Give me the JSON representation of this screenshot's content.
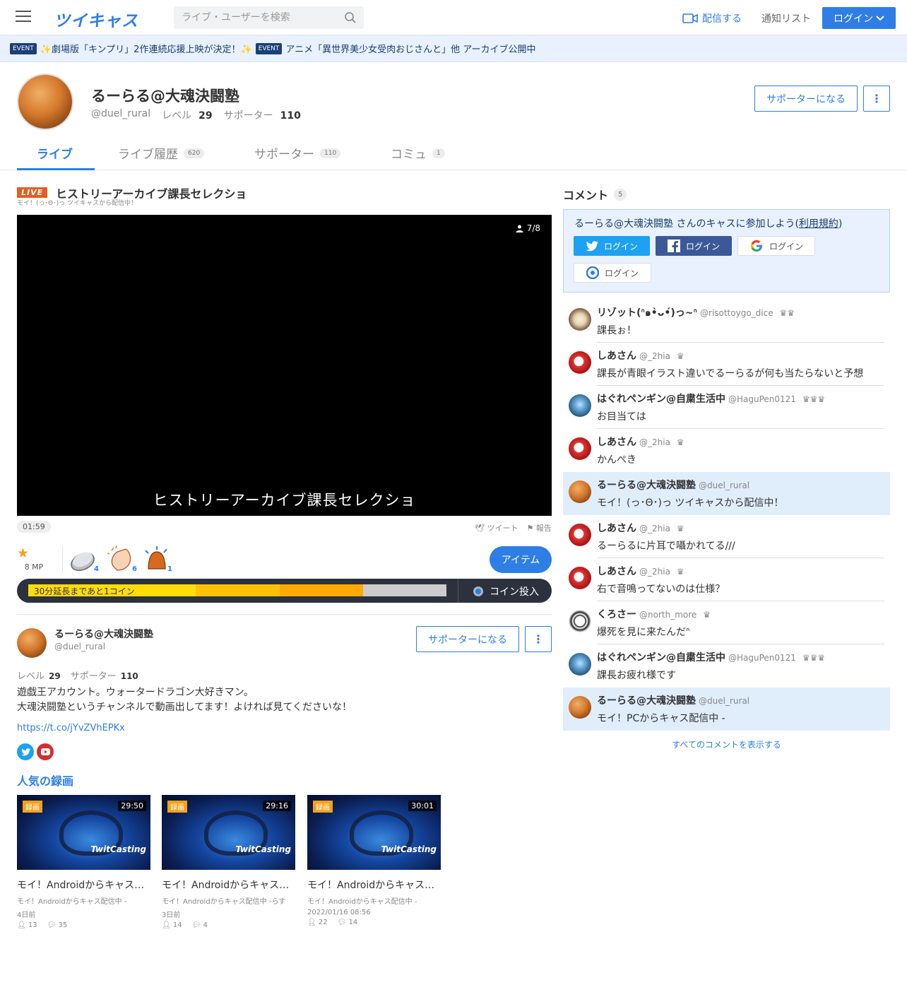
{
  "header": {
    "logo": "ツイキャス",
    "search_placeholder": "ライブ・ユーザーを検索",
    "cast_label": "配信する",
    "notify_label": "通知リスト",
    "login_label": "ログイン"
  },
  "events": [
    {
      "tag": "EVENT",
      "text": "✨劇場版「キンプリ」2作連続応援上映が決定！✨"
    },
    {
      "tag": "EVENT",
      "text": "アニメ「異世界美少女受肉おじさんと」他 アーカイブ公開中"
    }
  ],
  "profile": {
    "name": "るーらる@大魂決闘塾",
    "handle": "@duel_rural",
    "level_label": "レベル",
    "level": "29",
    "supporter_label": "サポーター",
    "supporters": "110",
    "supporter_button": "サポーターになる",
    "more": "⋮"
  },
  "tabs": [
    {
      "label": "ライブ",
      "count": ""
    },
    {
      "label": "ライブ履歴",
      "count": "620"
    },
    {
      "label": "サポーター",
      "count": "110"
    },
    {
      "label": "コミュ",
      "count": "1"
    }
  ],
  "live": {
    "tag": "LIVE",
    "title": "ヒストリーアーカイブ課長セレクショ",
    "subtitle": "モイ！(っ･Θ･)っ ツイキャスから配信中！",
    "viewers": "7/8",
    "player_title": "ヒストリーアーカイブ課長セレクショ",
    "time": "01:59",
    "tweet": "ツイート",
    "report": "報告",
    "mp": "8 MP",
    "gifts": [
      {
        "name": "coin",
        "count": "4"
      },
      {
        "name": "clap",
        "count": "6"
      },
      {
        "name": "bell",
        "count": "1"
      }
    ],
    "item_button": "アイテム",
    "progress_label": "30分延長まであと1コイン",
    "progress": 0.81,
    "coin_button": "コイン投入"
  },
  "about": {
    "name": "るーらる@大魂決闘塾",
    "handle": "@duel_rural",
    "supporter_button": "サポーターになる",
    "level_label": "レベル",
    "level": "29",
    "supporter_label": "サポーター",
    "supporters": "110",
    "bio1": "遊戯王アカウント。ウォータードラゴン大好きマン。",
    "bio2": "大魂決闘塾というチャンネルで動画出してます！よければ見てくださいな！",
    "link": "https://t.co/jYvZVhEPKx",
    "popular_title": "人気の録画"
  },
  "recordings": [
    {
      "tag": "録画",
      "duration": "29:50",
      "title": "モイ！Androidからキャス配信中 -",
      "sub": "モイ！Androidからキャス配信中 -",
      "date": "4日前",
      "viewers": "13",
      "comments": "35"
    },
    {
      "tag": "録画",
      "duration": "29:16",
      "title": "モイ！Androidからキャス配信中 -",
      "sub": "モイ！Androidからキャス配信中 -らす",
      "date": "3日前",
      "viewers": "14",
      "comments": "4"
    },
    {
      "tag": "録画",
      "duration": "30:01",
      "title": "モイ！Androidからキャス配信中 -",
      "sub": "モイ！Androidからキャス配信中 -",
      "date": "2022/01/16 08:56",
      "viewers": "22",
      "comments": "14"
    }
  ],
  "comments_panel": {
    "title": "コメント",
    "count": "5",
    "join_prefix": "るーらる@大魂決闘塾 さんのキャスに参加しよう(",
    "join_link": "利用規約",
    "join_suffix": ")",
    "login_twitter": "ログイン",
    "login_facebook": "ログイン",
    "login_google": "ログイン",
    "login_other": "ログイン",
    "show_all": "すべてのコメントを表示する"
  },
  "comments": [
    {
      "name": "リゾット(ᐢ๑•̀ᴗ•́)っ~ᐢ",
      "id": "@risottoygo_dice",
      "badge": "♛♛",
      "text": "課長ぉ！",
      "avatar": "mix",
      "highlight": false
    },
    {
      "name": "しあさん",
      "id": "@_2hia",
      "badge": "♛",
      "text": "課長が青眼イラスト違いでるーらるが何も当たらないと予想",
      "avatar": "red",
      "highlight": false
    },
    {
      "name": "はぐれペンギン@自粛生活中",
      "id": "@HaguPen0121",
      "badge": "♛♛♛",
      "text": "お目当ては",
      "avatar": "peng",
      "highlight": false
    },
    {
      "name": "しあさん",
      "id": "@_2hia",
      "badge": "♛",
      "text": "かんぺき",
      "avatar": "red",
      "highlight": false
    },
    {
      "name": "るーらる@大魂決闘塾",
      "id": "@duel_rural",
      "badge": "",
      "text": "モイ！(っ･Θ･)っ ツイキャスから配信中！",
      "avatar": "bun",
      "highlight": true
    },
    {
      "name": "しあさん",
      "id": "@_2hia",
      "badge": "♛",
      "text": "るーらるに片耳で囁かれてる///",
      "avatar": "red",
      "highlight": false
    },
    {
      "name": "しあさん",
      "id": "@_2hia",
      "badge": "♛",
      "text": "右で音鳴ってないのは仕様？",
      "avatar": "red",
      "highlight": false
    },
    {
      "name": "くろさー",
      "id": "@north_more",
      "badge": "♛",
      "text": "爆死を見に来たんだᐢ",
      "avatar": "bw",
      "highlight": false
    },
    {
      "name": "はぐれペンギン@自粛生活中",
      "id": "@HaguPen0121",
      "badge": "♛♛♛",
      "text": "課長お疲れ様です",
      "avatar": "peng",
      "highlight": false
    },
    {
      "name": "るーらる@大魂決闘塾",
      "id": "@duel_rural",
      "badge": "",
      "text": "モイ！PCからキャス配信中 -",
      "avatar": "bun",
      "highlight": true
    }
  ]
}
